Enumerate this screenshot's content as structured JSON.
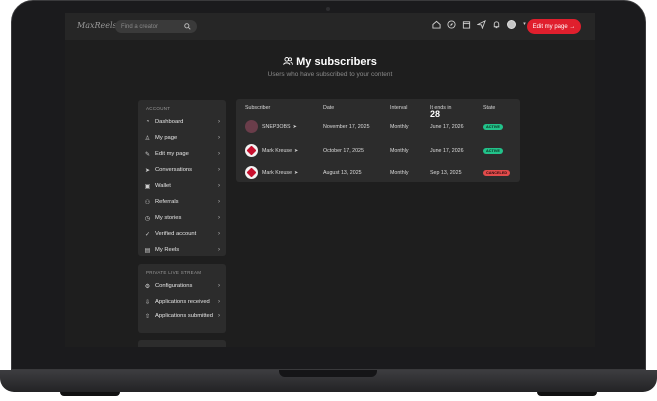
{
  "header": {
    "logo_text": "MaxReels",
    "search_placeholder": "Find a creator",
    "edit_button": "Edit my page →"
  },
  "page": {
    "title": "My subscribers",
    "subtitle": "Users who have subscribed to your content"
  },
  "sidebar": {
    "account_heading": "ACCOUNT",
    "account_items": [
      {
        "label": "Dashboard",
        "icon": "dashboard-icon"
      },
      {
        "label": "My page",
        "icon": "user-icon"
      },
      {
        "label": "Edit my page",
        "icon": "pencil-icon"
      },
      {
        "label": "Conversations",
        "icon": "send-icon"
      },
      {
        "label": "Wallet",
        "icon": "wallet-icon"
      },
      {
        "label": "Referrals",
        "icon": "referrals-icon"
      },
      {
        "label": "My stories",
        "icon": "clock-icon"
      },
      {
        "label": "Verified account",
        "icon": "verified-icon"
      },
      {
        "label": "My Reels",
        "icon": "reels-icon"
      }
    ],
    "live_heading": "PRIVATE LIVE STREAM",
    "live_items": [
      {
        "label": "Configurations",
        "icon": "gear-icon"
      },
      {
        "label": "Applications received",
        "icon": "inbox-icon"
      },
      {
        "label": "Applications submitted",
        "icon": "outbox-icon"
      }
    ]
  },
  "table": {
    "headers": {
      "subscriber": "Subscriber",
      "date": "Date",
      "interval": "Interval",
      "ends": "It ends in",
      "ends_value": "28",
      "state": "State"
    },
    "rows": [
      {
        "name": "SNEP3OBS",
        "date": "November 17, 2025",
        "interval": "Monthly",
        "ends": "June 17, 2026",
        "state": "ACTIVE"
      },
      {
        "name": "Mark Kreuse",
        "date": "October 17, 2025",
        "interval": "Monthly",
        "ends": "June 17, 2026",
        "state": "ACTIVE"
      },
      {
        "name": "Mark Kreuse",
        "date": "August 13, 2025",
        "interval": "Monthly",
        "ends": "Sep 13, 2025",
        "state": "CANCELED"
      }
    ]
  },
  "colors": {
    "accent": "#e01f2d",
    "active": "#22c28a",
    "canceled": "#e14b4b",
    "background": "#1e1e1e",
    "card": "#2c2c2c"
  }
}
